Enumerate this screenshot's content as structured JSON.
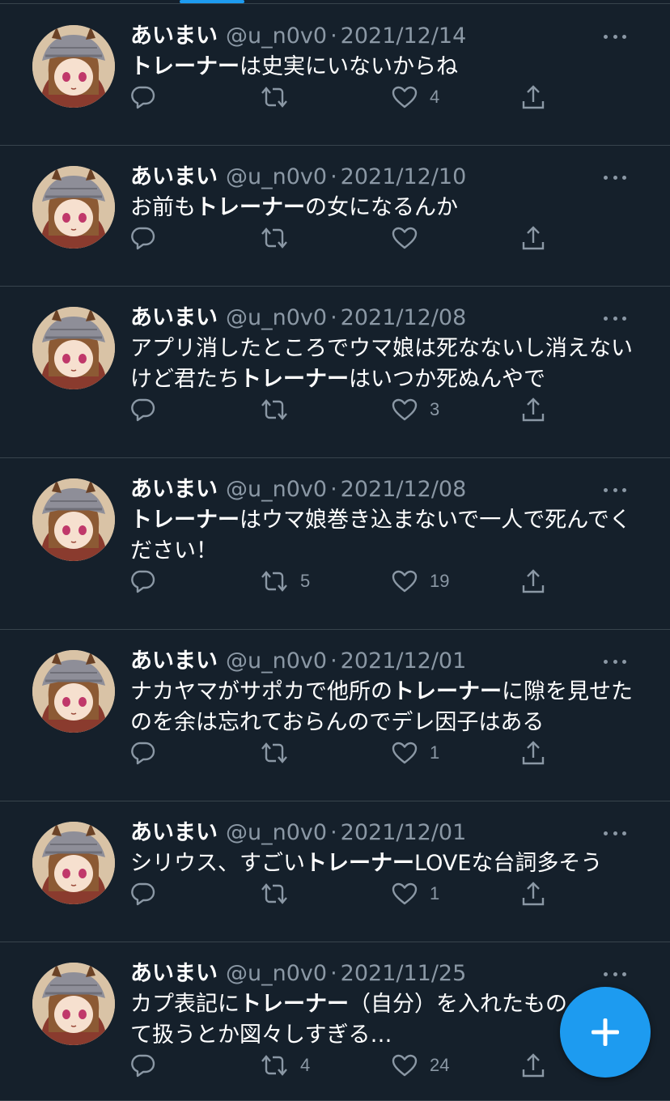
{
  "colors": {
    "background": "#15202b",
    "divider": "#38444d",
    "secondary_text": "#8b98a5",
    "accent": "#1d9bf0"
  },
  "tweets": [
    {
      "name": "あいまい",
      "handle": "@u_n0v0",
      "separator": "·",
      "date": "2021/12/14",
      "text": [
        {
          "t": "トレーナー",
          "b": true
        },
        {
          "t": "は史実にいないからね",
          "b": false
        }
      ],
      "likes": "4",
      "retweets": "",
      "replies": ""
    },
    {
      "name": "あいまい",
      "handle": "@u_n0v0",
      "separator": "·",
      "date": "2021/12/10",
      "text": [
        {
          "t": "お前も",
          "b": false
        },
        {
          "t": "トレーナー",
          "b": true
        },
        {
          "t": "の女になるんか",
          "b": false
        }
      ],
      "likes": "",
      "retweets": "",
      "replies": ""
    },
    {
      "name": "あいまい",
      "handle": "@u_n0v0",
      "separator": "·",
      "date": "2021/12/08",
      "text": [
        {
          "t": "アプリ消したところでウマ娘は死なないし消えないけど君たち",
          "b": false
        },
        {
          "t": "トレーナー",
          "b": true
        },
        {
          "t": "はいつか死ぬんやで",
          "b": false
        }
      ],
      "likes": "3",
      "retweets": "",
      "replies": ""
    },
    {
      "name": "あいまい",
      "handle": "@u_n0v0",
      "separator": "·",
      "date": "2021/12/08",
      "text": [
        {
          "t": "トレーナー",
          "b": true
        },
        {
          "t": "はウマ娘巻き込まないで一人で死んでください！",
          "b": false
        }
      ],
      "likes": "19",
      "retweets": "5",
      "replies": ""
    },
    {
      "name": "あいまい",
      "handle": "@u_n0v0",
      "separator": "·",
      "date": "2021/12/01",
      "text": [
        {
          "t": "ナカヤマがサポカで他所の",
          "b": false
        },
        {
          "t": "トレーナー",
          "b": true
        },
        {
          "t": "に隙を見せたのを余は忘れておらんのでデレ因子はある",
          "b": false
        }
      ],
      "likes": "1",
      "retweets": "",
      "replies": ""
    },
    {
      "name": "あいまい",
      "handle": "@u_n0v0",
      "separator": "·",
      "date": "2021/12/01",
      "text": [
        {
          "t": "シリウス、すごい",
          "b": false
        },
        {
          "t": "トレーナー",
          "b": true
        },
        {
          "t": "LOVEな台詞多そう",
          "b": false
        }
      ],
      "likes": "1",
      "retweets": "",
      "replies": ""
    },
    {
      "name": "あいまい",
      "handle": "@u_n0v0",
      "separator": "·",
      "date": "2021/11/25",
      "text": [
        {
          "t": "カプ表記に",
          "b": false
        },
        {
          "t": "トレーナー",
          "b": true
        },
        {
          "t": "（自分）を入れたもの",
          "b": false
        },
        {
          "br": true
        },
        {
          "t": "て扱うとか図々しすぎる…",
          "b": false
        }
      ],
      "likes": "24",
      "retweets": "4",
      "replies": ""
    }
  ],
  "icons": {
    "reply": "reply-icon",
    "retweet": "retweet-icon",
    "like": "heart-icon",
    "share": "share-icon",
    "more": "more-icon",
    "compose": "plus-icon"
  }
}
